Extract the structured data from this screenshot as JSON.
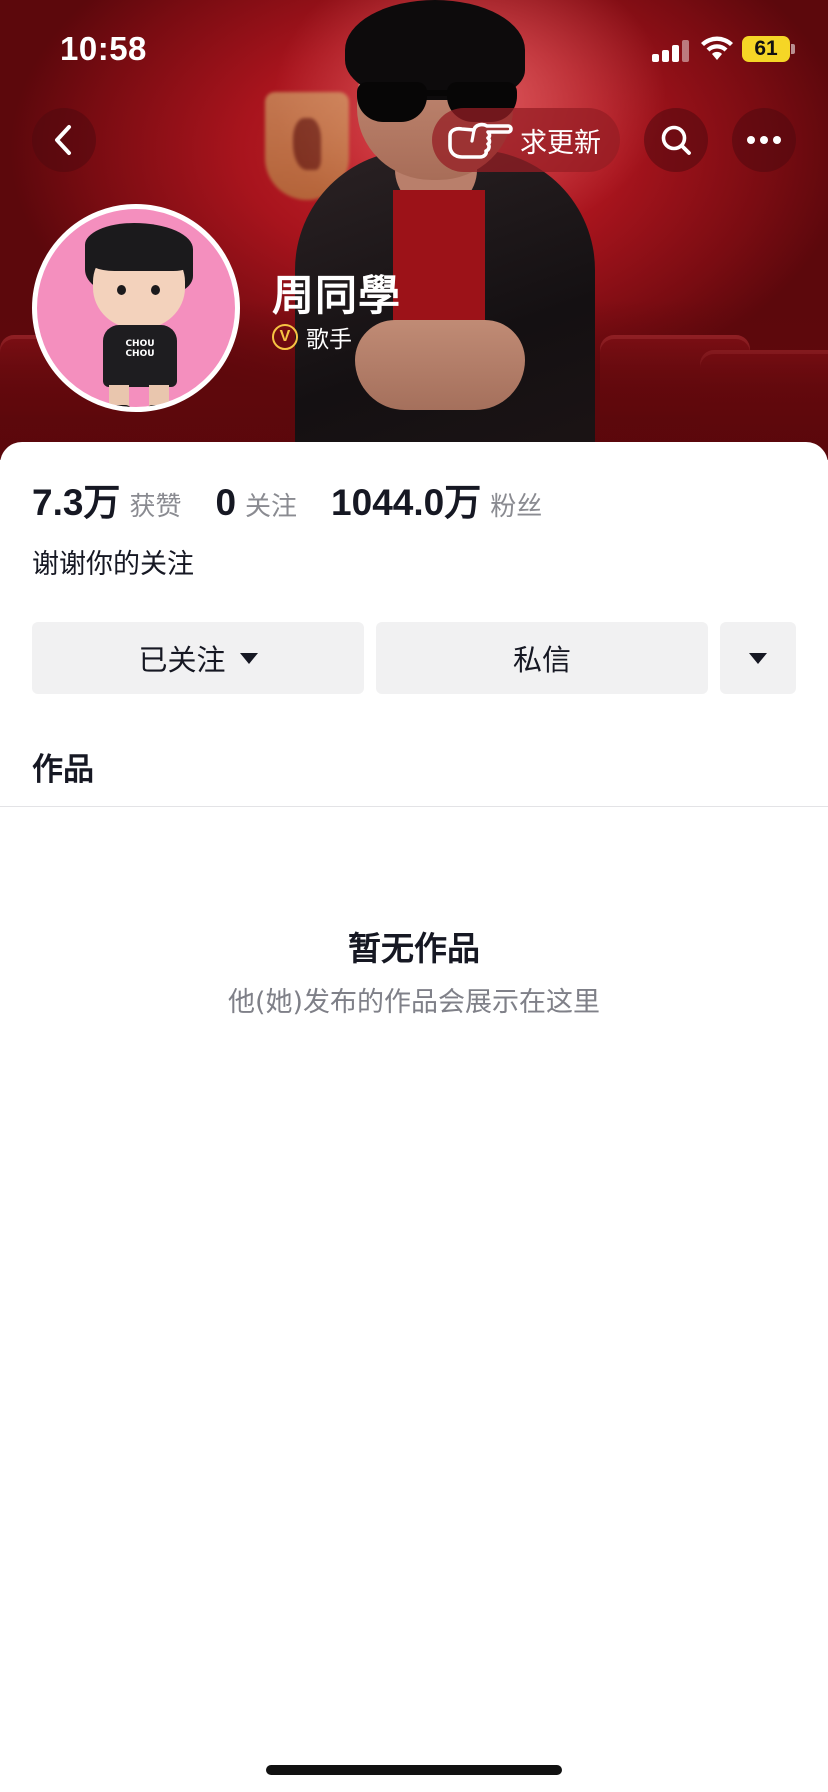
{
  "status_bar": {
    "time": "10:58",
    "battery": "61",
    "battery_color": "#f5d626"
  },
  "nav": {
    "back_icon": "chevron-left-icon",
    "update_label": "求更新",
    "update_icon": "pointing-hand-icon",
    "search_icon": "search-icon",
    "more_icon": "more-dots-icon"
  },
  "profile": {
    "name": "周同學",
    "verified_badge": "V",
    "verified_role": "歌手",
    "badge_color": "#f6c343",
    "avatar_bg": "#f48fbe",
    "avatar_shirt_text": "CHOU CHOU",
    "bio": "谢谢你的关注"
  },
  "stats": [
    {
      "value": "7.3万",
      "label": "获赞"
    },
    {
      "value": "0",
      "label": "关注"
    },
    {
      "value": "1044.0万",
      "label": "粉丝"
    }
  ],
  "actions": {
    "follow_label": "已关注",
    "message_label": "私信"
  },
  "tabs": {
    "works_label": "作品"
  },
  "empty_state": {
    "title": "暂无作品",
    "subtitle": "他(她)发布的作品会展示在这里"
  }
}
